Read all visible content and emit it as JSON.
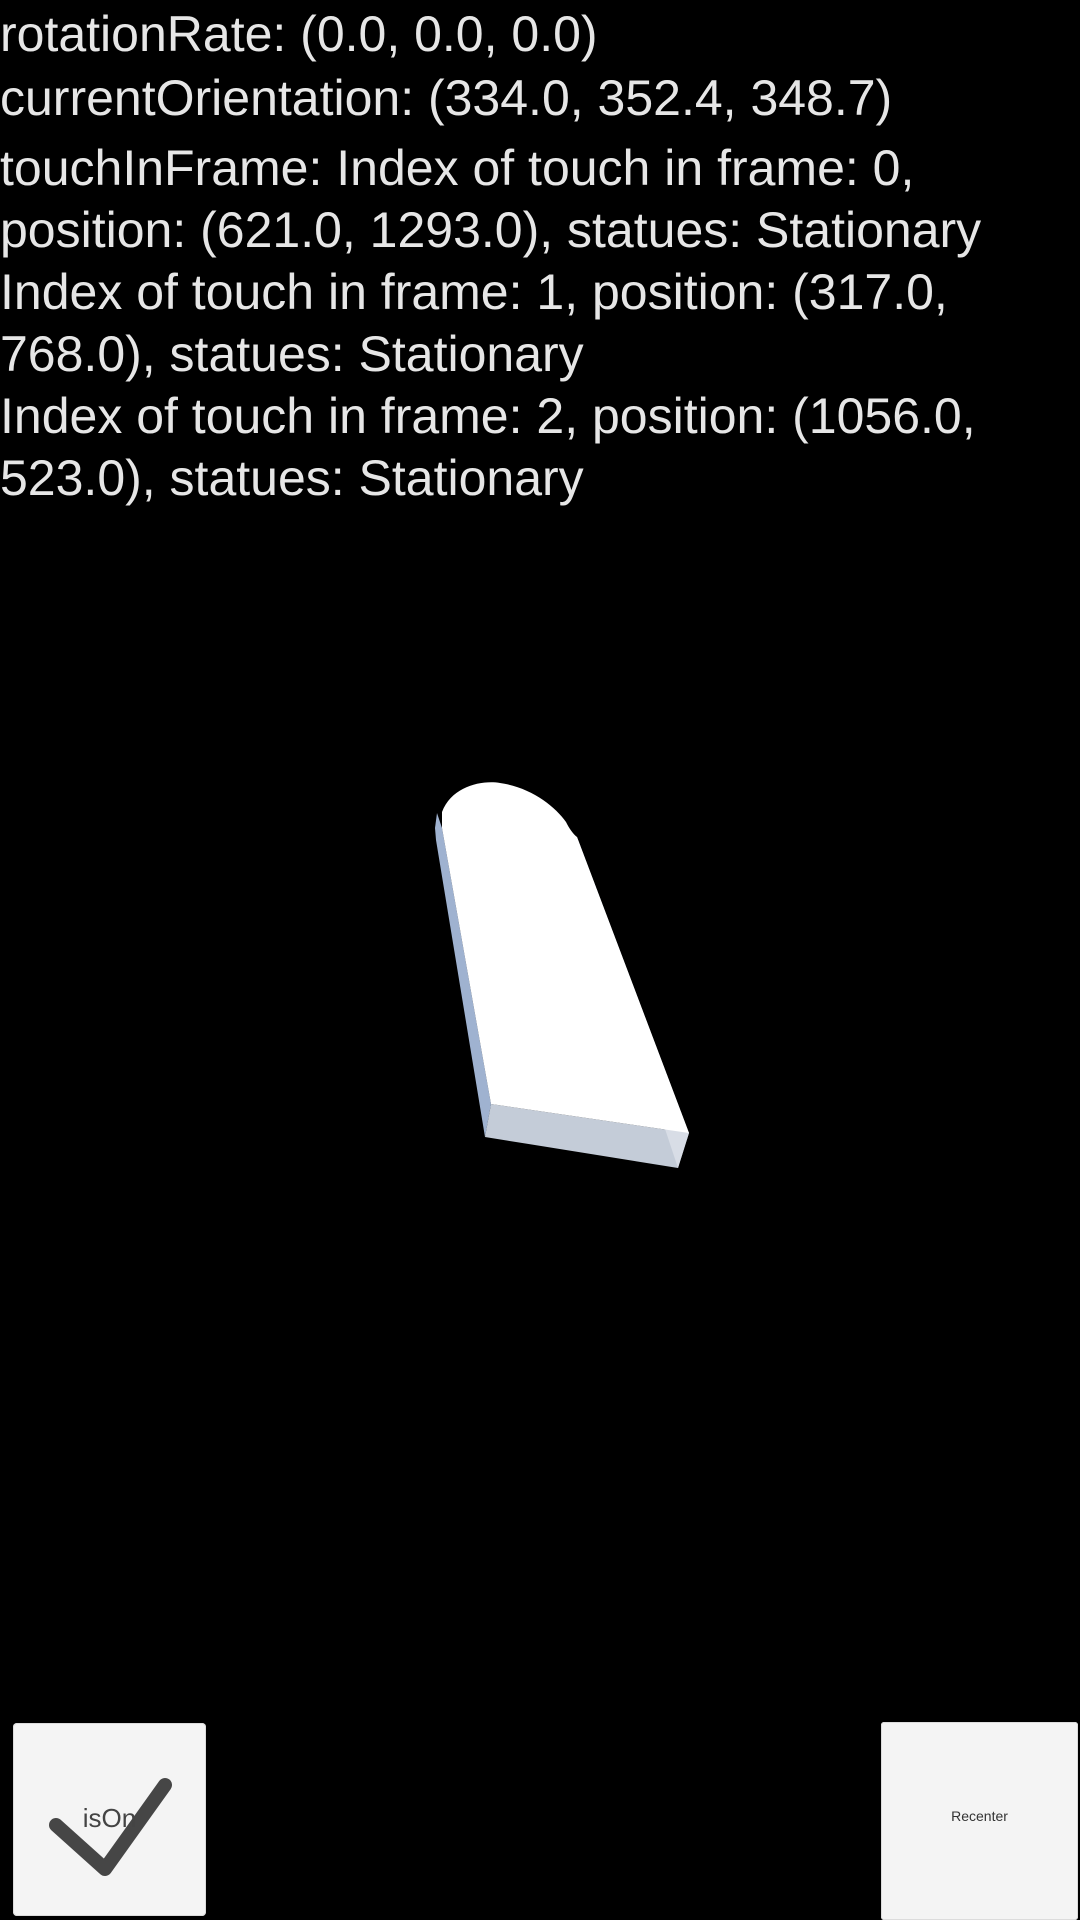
{
  "debug": {
    "rotation_rate": "rotationRate: (0.0, 0.0, 0.0)",
    "current_orientation": "currentOrientation: (334.0, 352.4, 348.7)",
    "touch_lines": [
      "touchInFrame: Index of touch in frame: 0,",
      "position: (621.0, 1293.0), statues: Stationary",
      "Index of touch in frame: 1, position: (317.0,",
      "768.0), statues: Stationary",
      "Index of touch in frame: 2, position: (1056.0,",
      "523.0), statues: Stationary"
    ]
  },
  "scene": {
    "object_icon": "rounded-slab-3d-shape",
    "colors": {
      "top_face": "#ffffff",
      "side_face": "#9fb2d0",
      "front_face": "#c4ccd8"
    }
  },
  "controls": {
    "toggle": {
      "label": "isOn",
      "icon": "checkmark-icon",
      "checked": true
    },
    "recenter_label": "Recenter"
  },
  "colors": {
    "background": "#000000",
    "text": "#e6e6e6",
    "button_bg": "#f4f4f4"
  }
}
